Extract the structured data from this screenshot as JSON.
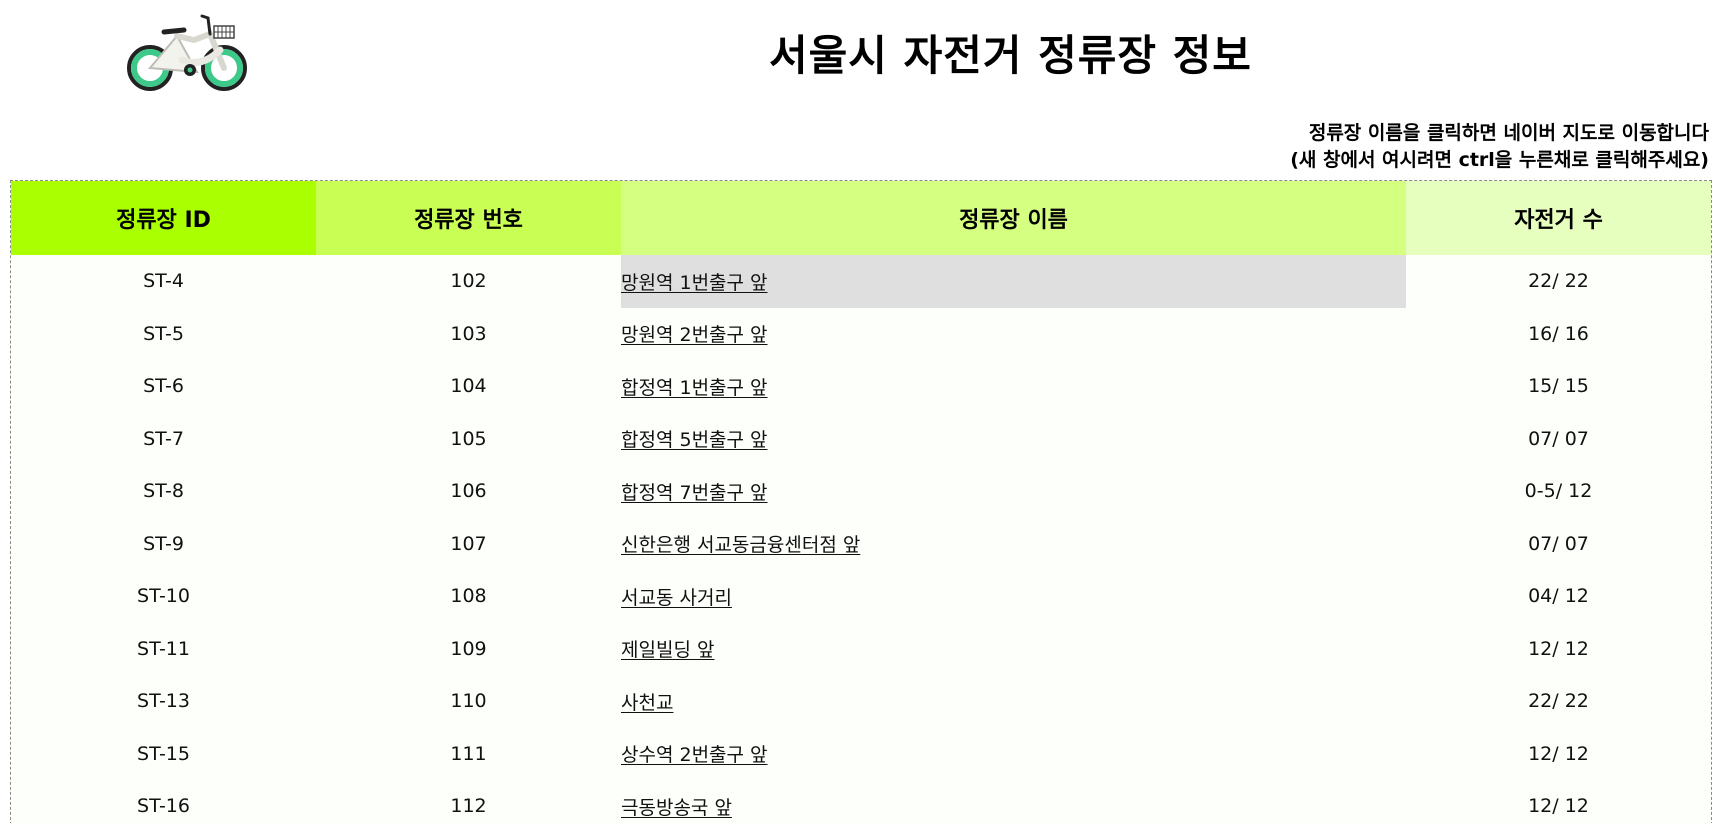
{
  "header": {
    "title": "서울시 자전거 정류장 정보",
    "note_line1": "정류장 이름을 클릭하면 네이버 지도로 이동합니다",
    "note_line2": "(새 창에서 여시려면 ctrl을 누른채로 클릭해주세요)",
    "logo_icon": "bicycle-icon"
  },
  "colors": {
    "header_id": "#aaff00",
    "header_number": "#c9ff55",
    "header_name": "#d5ff80",
    "header_bikes": "#e6ffbe",
    "bike_wheel": "#3cc98a"
  },
  "table": {
    "columns": [
      "정류장 ID",
      "정류장 번호",
      "정류장 이름",
      "자전거 수"
    ],
    "rows": [
      {
        "id": "ST-4",
        "number": "102",
        "name": "망원역 1번출구 앞",
        "bikes": "22/ 22"
      },
      {
        "id": "ST-5",
        "number": "103",
        "name": "망원역 2번출구 앞",
        "bikes": "16/ 16"
      },
      {
        "id": "ST-6",
        "number": "104",
        "name": "합정역 1번출구 앞",
        "bikes": "15/ 15"
      },
      {
        "id": "ST-7",
        "number": "105",
        "name": "합정역 5번출구 앞",
        "bikes": "07/ 07"
      },
      {
        "id": "ST-8",
        "number": "106",
        "name": "합정역 7번출구 앞",
        "bikes": "0-5/ 12"
      },
      {
        "id": "ST-9",
        "number": "107",
        "name": "신한은행 서교동금융센터점 앞",
        "bikes": "07/ 07"
      },
      {
        "id": "ST-10",
        "number": "108",
        "name": "서교동 사거리",
        "bikes": "04/ 12"
      },
      {
        "id": "ST-11",
        "number": "109",
        "name": "제일빌딩 앞",
        "bikes": "12/ 12"
      },
      {
        "id": "ST-13",
        "number": "110",
        "name": "사천교",
        "bikes": "22/ 22"
      },
      {
        "id": "ST-15",
        "number": "111",
        "name": "상수역 2번출구 앞",
        "bikes": "12/ 12"
      },
      {
        "id": "ST-16",
        "number": "112",
        "name": "극동방송국 앞",
        "bikes": "12/ 12"
      }
    ]
  }
}
